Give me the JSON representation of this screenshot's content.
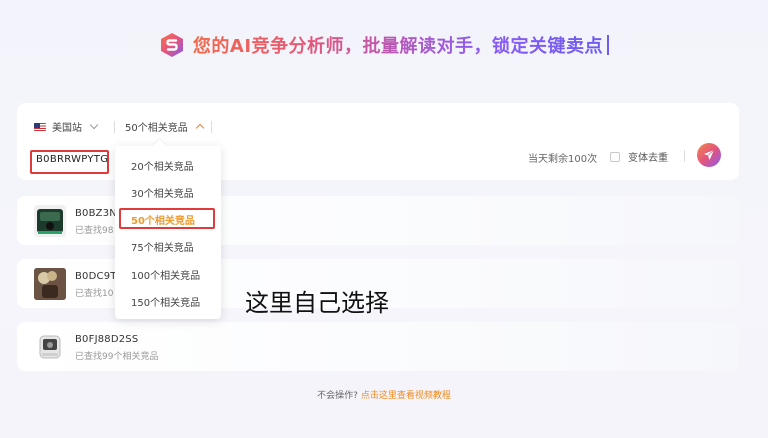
{
  "header": {
    "title": "您的AI竞争分析师，批量解读对手，锁定关键卖点",
    "logo_icon": "brand-s-logo-icon"
  },
  "search": {
    "site_label": "美国站",
    "count_label": "50个相关竞品",
    "asin_value": "B0BRRWPYTG",
    "quota_text": "当天剩余100次",
    "dedupe_label": "变体去重",
    "dedupe_checked": false,
    "send_icon": "paper-plane-icon"
  },
  "dropdown": {
    "options": [
      "20个相关竞品",
      "30个相关竞品",
      "50个相关竞品",
      "75个相关竞品",
      "100个相关竞品",
      "150个相关竞品"
    ],
    "selected": "50个相关竞品"
  },
  "results": [
    {
      "asin": "B0BZ3N",
      "found": "已查找98"
    },
    {
      "asin": "B0DC9T",
      "found": "已查找10"
    },
    {
      "asin": "B0FJ88D2SS",
      "found": "已查找99个相关竞品"
    }
  ],
  "annotation": "这里自己选择",
  "footer": {
    "question": "不会操作?",
    "link": "点击这里查看视频教程"
  },
  "colors": {
    "accent_orange": "#f09a2e",
    "highlight_red": "#e03a3a",
    "gradient_purple": "#8b5cf6"
  }
}
